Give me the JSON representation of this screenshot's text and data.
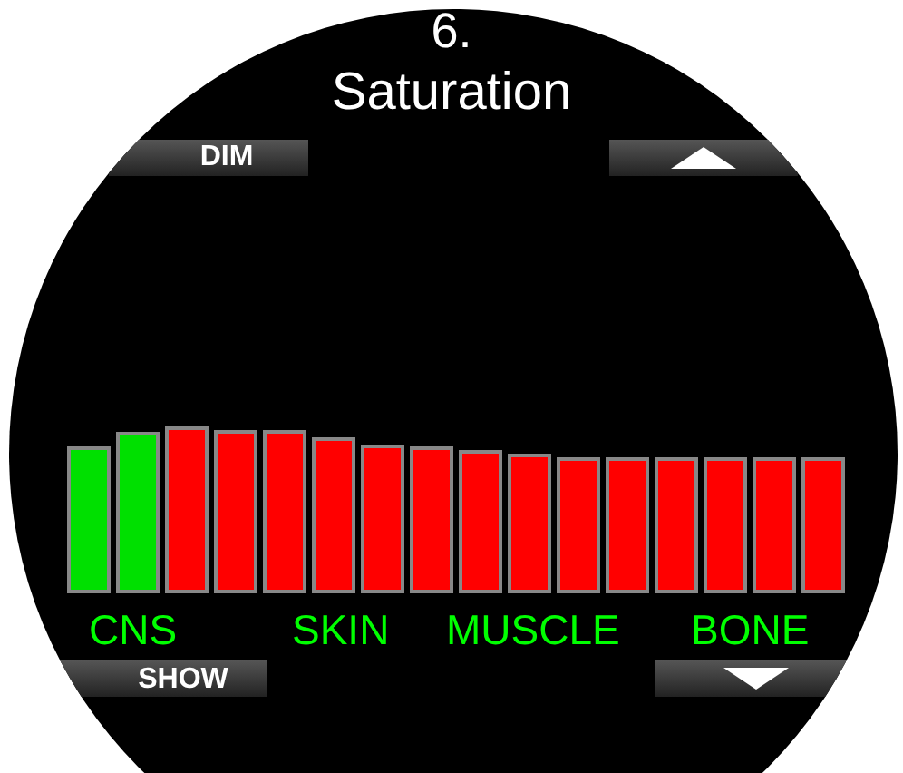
{
  "screen": {
    "number": "6.",
    "title": "Saturation"
  },
  "top_softkeys": [
    {
      "kind": "text",
      "label": "DIM"
    },
    {
      "kind": "arrow-up"
    }
  ],
  "compartments": [
    {
      "level": 0.74,
      "color": "#00e000"
    },
    {
      "level": 0.81,
      "color": "#00e000"
    },
    {
      "level": 0.84,
      "color": "#ff0000"
    },
    {
      "level": 0.82,
      "color": "#ff0000"
    },
    {
      "level": 0.82,
      "color": "#ff0000"
    },
    {
      "level": 0.78,
      "color": "#ff0000"
    },
    {
      "level": 0.75,
      "color": "#ff0000"
    },
    {
      "level": 0.74,
      "color": "#ff0000"
    },
    {
      "level": 0.72,
      "color": "#ff0000"
    },
    {
      "level": 0.7,
      "color": "#ff0000"
    },
    {
      "level": 0.68,
      "color": "#ff0000"
    },
    {
      "level": 0.68,
      "color": "#ff0000"
    },
    {
      "level": 0.68,
      "color": "#ff0000"
    },
    {
      "level": 0.68,
      "color": "#ff0000"
    },
    {
      "level": 0.68,
      "color": "#ff0000"
    },
    {
      "level": 0.68,
      "color": "#ff0000"
    }
  ],
  "tissue_labels": [
    "CNS",
    "SKIN",
    "MUSCLE",
    "BONE"
  ],
  "bottom_softkeys": [
    {
      "kind": "text",
      "label": "SHOW"
    },
    {
      "kind": "arrow-down"
    }
  ]
}
